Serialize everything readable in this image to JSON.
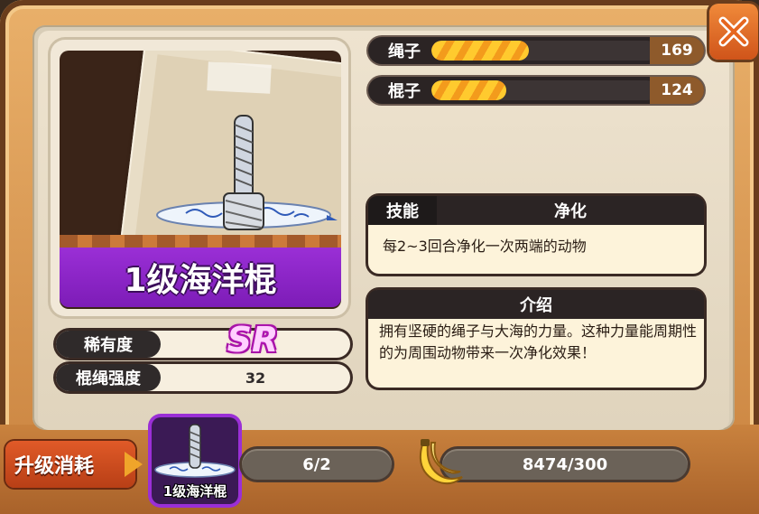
{
  "item": {
    "name": "1级海洋棍",
    "rarity_label": "稀有度",
    "rarity_value": "SR",
    "strength_label": "棍绳强度",
    "strength_value": "32"
  },
  "attributes": [
    {
      "label": "绳子",
      "value": "169",
      "fill": 0.43
    },
    {
      "label": "棍子",
      "value": "124",
      "fill": 0.33
    }
  ],
  "skill": {
    "header": "技能",
    "name": "净化",
    "description": "每2~3回合净化一次两端的动物"
  },
  "intro": {
    "header": "介绍",
    "text": "拥有坚硬的绳子与大海的力量。这种力量能周期性的为周围动物带来一次净化效果！"
  },
  "upgrade": {
    "label": "升级消耗",
    "slot_item_name": "1级海洋棍",
    "item_count": "6/2",
    "banana_count": "8474/300"
  },
  "icons": [
    "close-icon",
    "banana-icon",
    "ocean-stick-icon"
  ]
}
